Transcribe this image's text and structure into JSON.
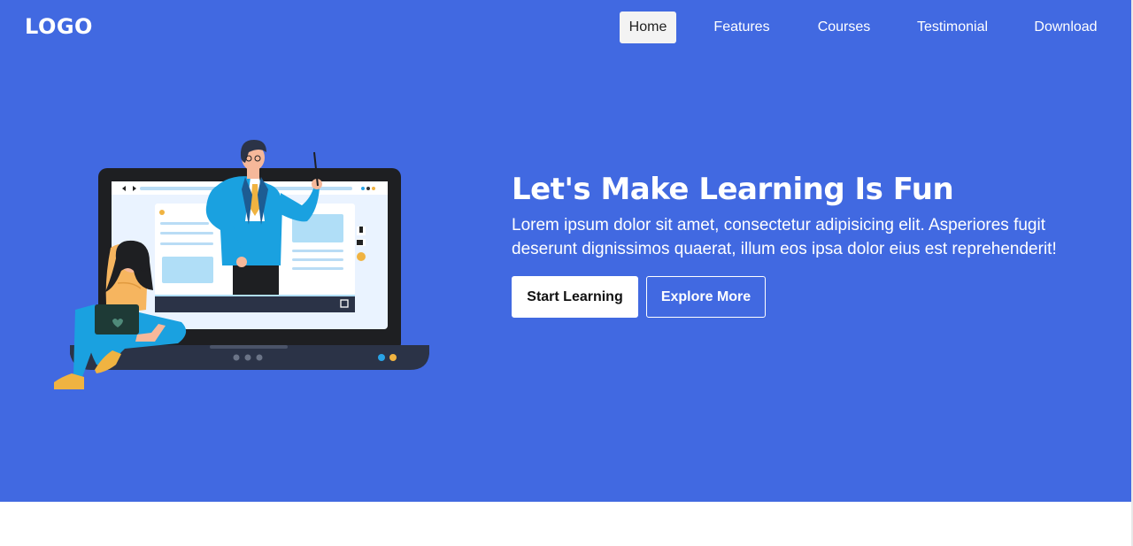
{
  "header": {
    "logo": "LOGO",
    "nav": [
      {
        "label": "Home",
        "active": true
      },
      {
        "label": "Features",
        "active": false
      },
      {
        "label": "Courses",
        "active": false
      },
      {
        "label": "Testimonial",
        "active": false
      },
      {
        "label": "Download",
        "active": false
      }
    ]
  },
  "hero": {
    "title": "Let's Make Learning Is Fun",
    "description": "Lorem ipsum dolor sit amet, consectetur adipisicing elit. Asperiores fugit deserunt dignissimos quaerat, illum eos ipsa dolor eius est reprehenderit!",
    "primary_button": "Start Learning",
    "secondary_button": "Explore More",
    "illustration": "online-learning-illustration"
  },
  "colors": {
    "hero_background": "#4169e1",
    "button_light": "#ffffff",
    "text": "#ffffff"
  }
}
